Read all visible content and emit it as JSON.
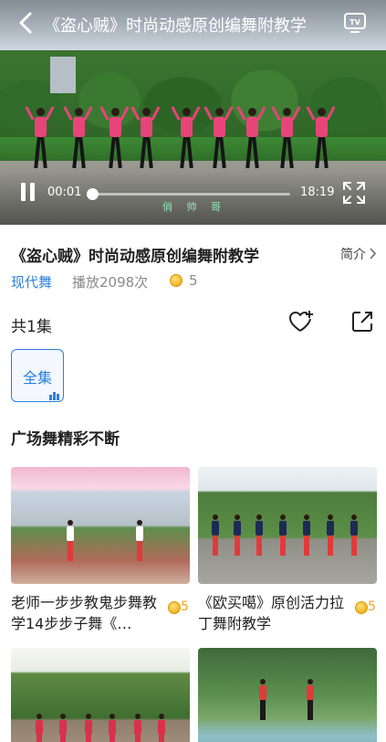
{
  "player": {
    "title": "《盗心贼》时尚动感原创编舞附教学",
    "current_time": "00:01",
    "total_time": "18:19",
    "progress_percent": 0.5,
    "watermark": "俏 帅 哥",
    "back_icon": "chevron-left-icon",
    "tv_icon": "tv-cast-icon",
    "play_state_icon": "pause-icon",
    "fullscreen_icon": "fullscreen-icon"
  },
  "info": {
    "title": "《盗心贼》时尚动感原创编舞附教学",
    "intro_label": "简介",
    "category": "现代舞",
    "play_count": "播放2098次",
    "coins": "5",
    "accent_color": "#2b7fdb"
  },
  "episodes": {
    "count_label": "共1集",
    "tab_label": "全集"
  },
  "recommendations": {
    "section_title": "广场舞精彩不断",
    "coin_color": "#f0a41c",
    "items": [
      {
        "title": "老师一步步教鬼步舞教学14步步子舞《…",
        "coins": "5"
      },
      {
        "title": "《欧买噶》原创活力拉丁舞附教学",
        "coins": "5"
      },
      {
        "title": "",
        "coins": ""
      },
      {
        "title": "",
        "coins": ""
      }
    ]
  }
}
